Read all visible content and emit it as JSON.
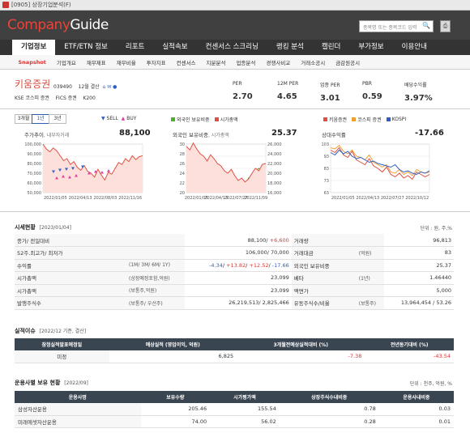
{
  "window": {
    "title": "[0905] 상장기업분석(F)"
  },
  "header": {
    "logo_a": "Company",
    "logo_b": "Guide",
    "search_placeholder": "종목명 또는 종목코드 입력",
    "print_label": "⎙"
  },
  "nav": {
    "items": [
      "기업정보",
      "ETF/ETN 정보",
      "리포트",
      "실적속보",
      "컨센서스 스크리닝",
      "랭킹 분석",
      "캘린더",
      "부가정보",
      "이용안내"
    ]
  },
  "subnav": {
    "items": [
      "Snapshot",
      "기업개요",
      "재무제표",
      "재무비율",
      "투자지표",
      "컨센서스",
      "지분분석",
      "업종분석",
      "경쟁사비교",
      "거래소공시",
      "금감원공시"
    ]
  },
  "company": {
    "name": "키움증권",
    "code": "039490",
    "fiscal": "12월 결산",
    "market": "KSE  코스피 증권",
    "fics": "FICS 증권",
    "index": "K200"
  },
  "metrics": [
    {
      "label": "PER",
      "value": "2.70"
    },
    {
      "label": "12M PER",
      "value": "4.65"
    },
    {
      "label": "업종 PER",
      "value": "3.01"
    },
    {
      "label": "PBR",
      "value": "0.59"
    },
    {
      "label": "배당수익률",
      "value": "3.97%"
    }
  ],
  "period_tabs": [
    "3개월",
    "1년",
    "3년"
  ],
  "legends": {
    "c1": [
      "SELL",
      "BUY"
    ],
    "c2": [
      "외국인 보유비중",
      "시가총액"
    ],
    "c3": [
      "키움증권",
      "코스피 증권",
      "KOSPI"
    ]
  },
  "charts": {
    "c1": {
      "title": "주가추이",
      "sub": ", 내부자거래",
      "value": "88,100"
    },
    "c2": {
      "title": "외국인 보유비중",
      "sub": ", 시가총액",
      "value": "25.37"
    },
    "c3": {
      "title": "상대수익률",
      "sub": "",
      "value": "-17.66"
    }
  },
  "chart_data": [
    {
      "type": "line",
      "x": [
        "2022/01/05",
        "2022/04/13",
        "2022/08/03",
        "2022/11/16"
      ],
      "yticks": [
        "100,000",
        "90,000",
        "80,000",
        "70,000",
        "60,000",
        "50,000"
      ],
      "series": [
        {
          "name": "",
          "values": [
            100000,
            95000,
            92000,
            96000,
            93000,
            88000,
            83000,
            85000,
            79000,
            82000,
            76000,
            73000,
            78000,
            72000,
            70000,
            66000,
            74000,
            68000,
            63000,
            71000,
            69000,
            75000,
            81000,
            79000,
            85000,
            82000,
            88000,
            84000,
            87000,
            88100
          ]
        }
      ]
    },
    {
      "type": "line",
      "x": [
        "2022/01/05",
        "2022/04/13",
        "2022/07/27",
        "2022/11/09"
      ],
      "yticks_left": [
        "30",
        "28",
        "26",
        "24",
        "22",
        "20"
      ],
      "yticks_right": [
        "26,000",
        "24,000",
        "22,000",
        "20,000",
        "18,000",
        "16,000"
      ],
      "series": [
        {
          "name": "외국인 보유비중",
          "values": [
            25.5,
            24.5,
            24.0,
            23.8,
            22.5,
            22.0,
            23.5,
            23.0,
            22.0,
            21.5,
            22.5,
            23.5,
            24.0,
            23.0,
            22.0,
            21.0,
            20.5,
            21.5,
            23.0,
            23.5,
            24.5,
            25.0,
            24.0,
            25.37
          ]
        },
        {
          "name": "시가총액",
          "values": [
            25500,
            24800,
            26200,
            25000,
            24000,
            23500,
            22500,
            23800,
            23000,
            22000,
            21500,
            20500,
            20000,
            20800,
            19500,
            18500,
            19000,
            18200,
            18800,
            20000,
            21000,
            20500,
            21800,
            22000
          ]
        }
      ]
    },
    {
      "type": "line",
      "x": [
        "2022/01/05",
        "2022/04/13",
        "2022/07/27",
        "2022/10/12"
      ],
      "yticks": [
        "103",
        "93",
        "83",
        "73",
        "63"
      ],
      "series": [
        {
          "name": "키움증권",
          "values": [
            98,
            96,
            100,
            94,
            92,
            97,
            90,
            88,
            86,
            91,
            85,
            83,
            80,
            84,
            78,
            76,
            79,
            75,
            77,
            74,
            80,
            78,
            76,
            78
          ]
        },
        {
          "name": "코스피 증권",
          "values": [
            100,
            99,
            102,
            97,
            95,
            98,
            93,
            92,
            90,
            94,
            88,
            86,
            84,
            86,
            80,
            79,
            82,
            78,
            80,
            77,
            82,
            80,
            79,
            80
          ]
        },
        {
          "name": "KOSPI",
          "values": [
            96,
            94,
            98,
            95,
            97,
            93,
            91,
            92,
            90,
            88,
            89,
            87,
            86,
            85,
            84,
            86,
            82,
            80,
            81,
            79,
            78,
            80,
            79,
            81
          ]
        }
      ]
    }
  ],
  "market": {
    "title": "시세현황",
    "date": "[2023/01/04]",
    "unit": "단위 : 원, 주,%",
    "rows": [
      {
        "k": "종가/ 전일대비",
        "s": "",
        "v": "88,100/ +6,600",
        "k2": "거래량",
        "s2": "",
        "v2": "96,813"
      },
      {
        "k": "52주.최고가/ 최저가",
        "s": "",
        "v": "106,000/ 70,000",
        "k2": "거래대금",
        "s2": "(억원)",
        "v2": "83"
      },
      {
        "k": "수익률",
        "s": "(1M/ 3M/ 6M/ 1Y)",
        "v": "-4.34/ +13.82/ +12.52/ -17.66",
        "k2": "외국인 보유비중",
        "s2": "",
        "v2": "25.37"
      },
      {
        "k": "시가총액",
        "s": "(상장예정포함,억원)",
        "v": "23,099",
        "k2": "베타",
        "s2": "(1년)",
        "v2": "1.46440"
      },
      {
        "k": "시가총액",
        "s": "(보통주,억원)",
        "v": "23,099",
        "k2": "액면가",
        "s2": "",
        "v2": "5,000"
      },
      {
        "k": "발행주식수",
        "s": "(보통주/ 우선주)",
        "v": "26,219,513/ 2,825,466",
        "k2": "유동주식수/비율",
        "s2": "(보통주)",
        "v2": "13,964,454 / 53.26"
      }
    ]
  },
  "earnings": {
    "title": "실적이슈",
    "date": "[2022/12 기준, 결산]",
    "headers": [
      "잠정실적발표예정일",
      "예상실적 (영업이익, 억원)",
      "3개월전예상실적대비 (%)",
      "전년동기대비 (%)"
    ],
    "row": [
      "미정",
      "6,825",
      "-7.38",
      "-43.54"
    ]
  },
  "holders": {
    "title": "운용사별 보유 현황",
    "date": "[2022/09]",
    "unit": "단위 : 천주, 억원, %",
    "headers": [
      "운용사명",
      "보유수량",
      "시가평가액",
      "상장주식수내비중",
      "운용사내비중"
    ],
    "rows": [
      [
        "삼성자산운용",
        "205.46",
        "155.54",
        "0.78",
        "0.03"
      ],
      [
        "미래에셋자산운용",
        "74.00",
        "56.02",
        "0.28",
        "0.01"
      ]
    ]
  }
}
